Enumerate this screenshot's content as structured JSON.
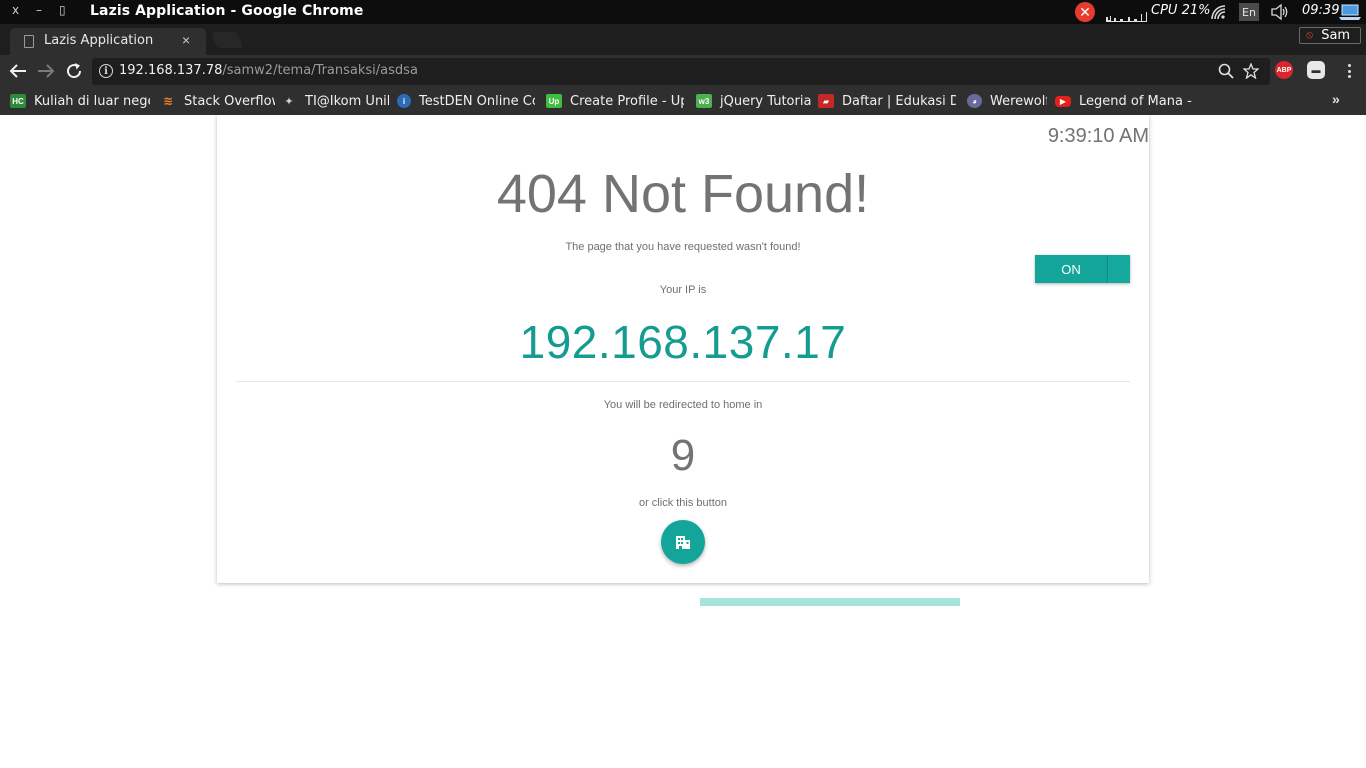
{
  "os": {
    "window_title": "Lazis Application - Google Chrome",
    "controls": {
      "close": "x",
      "minimize": "–",
      "maximize": "▯"
    },
    "cpu": "CPU 21%",
    "language": "En",
    "clock": "09:39"
  },
  "browser": {
    "tab": {
      "title": "Lazis Application",
      "close": "×"
    },
    "profile": "Sam",
    "url": {
      "host": "192.168.137.78",
      "path": "/samw2/tema/Transaksi/asdsa"
    },
    "bookmarks": [
      {
        "label": "Kuliah di luar negeri",
        "icon": "HC",
        "color": "#2e8b3a"
      },
      {
        "label": "Stack Overflow",
        "icon": "so",
        "color": "#f48024"
      },
      {
        "label": "TI@Ikom Unika",
        "icon": "ti",
        "color": "#555555"
      },
      {
        "label": "TestDEN Online Co",
        "icon": "i",
        "color": "#2c6bb5"
      },
      {
        "label": "Create Profile - Up",
        "icon": "Up",
        "color": "#3fbf3f"
      },
      {
        "label": "jQuery Tutorial",
        "icon": "w3",
        "color": "#4caf50"
      },
      {
        "label": "Daftar | Edukasi Dari",
        "icon": "d",
        "color": "#c62828"
      },
      {
        "label": "Werewolf",
        "icon": "w",
        "color": "#6a6a9a"
      },
      {
        "label": "Legend of Mana - O",
        "icon": "yt",
        "color": "#e62117"
      }
    ],
    "more": "»"
  },
  "page": {
    "time": "9:39:10 AM",
    "heading": "404 Not Found!",
    "message": "The page that you have requested wasn't found!",
    "ip_label": "Your IP is",
    "ip": "192.168.137.17",
    "redirect_text": "You will be redirected to home in",
    "countdown": "9",
    "button_hint": "or click this button",
    "toggle_label": "ON",
    "home_button_icon": "building-icon",
    "accent_color": "#13a59a"
  }
}
